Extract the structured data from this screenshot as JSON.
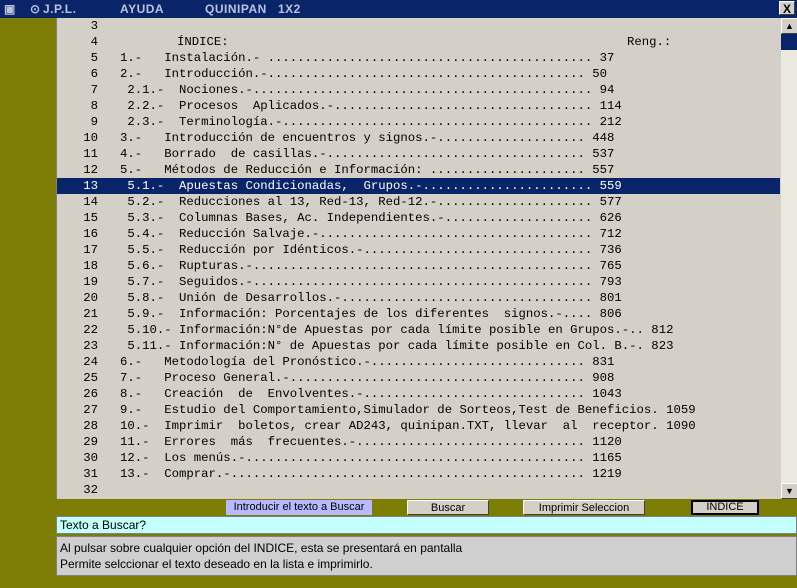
{
  "titlebar": {
    "app_name": "J.P.L.",
    "menu_help": "AYUDA",
    "program": "QUINIPAN",
    "mode": "1X2",
    "close_label": "X"
  },
  "index": {
    "heading": "ÍNDICE:",
    "reng_label": "Reng.:",
    "selected_row": 13,
    "rows": [
      {
        "n": "3",
        "text": ""
      },
      {
        "n": "4",
        "text": ""
      },
      {
        "n": "5",
        "text": "1.-   Instalación.- ............................................ 37"
      },
      {
        "n": "6",
        "text": "2.-   Introducción.-........................................... 50"
      },
      {
        "n": "7",
        "text": " 2.1.-  Nociones.-.............................................. 94"
      },
      {
        "n": "8",
        "text": " 2.2.-  Procesos  Aplicados.-................................... 114"
      },
      {
        "n": "9",
        "text": " 2.3.-  Terminología.-.......................................... 212"
      },
      {
        "n": "10",
        "text": "3.-   Introducción de encuentros y signos.-.................... 448"
      },
      {
        "n": "11",
        "text": "4.-   Borrado  de casillas.-................................... 537"
      },
      {
        "n": "12",
        "text": "5.-   Métodos de Reducción e Información: ..................... 557"
      },
      {
        "n": "13",
        "text": " 5.1.-  Apuestas Condicionadas,  Grupos.-....................... 559"
      },
      {
        "n": "14",
        "text": " 5.2.-  Reducciones al 13, Red-13, Red-12.-..................... 577"
      },
      {
        "n": "15",
        "text": " 5.3.-  Columnas Bases, Ac. Independientes.-.................... 626"
      },
      {
        "n": "16",
        "text": " 5.4.-  Reducción Salvaje.-..................................... 712"
      },
      {
        "n": "17",
        "text": " 5.5.-  Reducción por Idénticos.-............................... 736"
      },
      {
        "n": "18",
        "text": " 5.6.-  Rupturas.-.............................................. 765"
      },
      {
        "n": "19",
        "text": " 5.7.-  Seguidos.-.............................................. 793"
      },
      {
        "n": "20",
        "text": " 5.8.-  Unión de Desarrollos.-.................................. 801"
      },
      {
        "n": "21",
        "text": " 5.9.-  Información: Porcentajes de los diferentes  signos.-.... 806"
      },
      {
        "n": "22",
        "text": " 5.10.- Información:N°de Apuestas por cada límite posible en Grupos.-.. 812"
      },
      {
        "n": "23",
        "text": " 5.11.- Información:N° de Apuestas por cada límite posible en Col. B.-. 823"
      },
      {
        "n": "24",
        "text": "6.-   Metodología del Pronóstico.-............................. 831"
      },
      {
        "n": "25",
        "text": "7.-   Proceso General.-........................................ 908"
      },
      {
        "n": "26",
        "text": "8.-   Creación  de  Envolventes.-.............................. 1043"
      },
      {
        "n": "27",
        "text": "9.-   Estudio del Comportamiento,Simulador de Sorteos,Test de Beneficios. 1059"
      },
      {
        "n": "28",
        "text": "10.-  Imprimir  boletos, crear AD243, quinipan.TXT, llevar  al  receptor. 1090"
      },
      {
        "n": "29",
        "text": "11.-  Errores  más  frecuentes.-............................... 1120"
      },
      {
        "n": "30",
        "text": "12.-  Los menús.-.............................................. 1165"
      },
      {
        "n": "31",
        "text": "13.-  Comprar.-................................................ 1219"
      },
      {
        "n": "32",
        "text": ""
      }
    ]
  },
  "buttons": {
    "introducir": "Introducir el texto a Buscar",
    "buscar": "Buscar",
    "imprimir": "Imprimir Seleccion",
    "indice": "INDICE"
  },
  "search": {
    "value": "Texto a Buscar?"
  },
  "help": {
    "line1": "Al pulsar sobre cualquier opción del INDICE, esta se presentará en pantalla",
    "line2": "Permite selccionar el texto deseado en la lista e imprimirlo."
  },
  "colors": {
    "background": "#7d7d05",
    "selection": "#0a246a",
    "search_field": "#c4ffff",
    "introducir_button": "#b9b9ff"
  }
}
